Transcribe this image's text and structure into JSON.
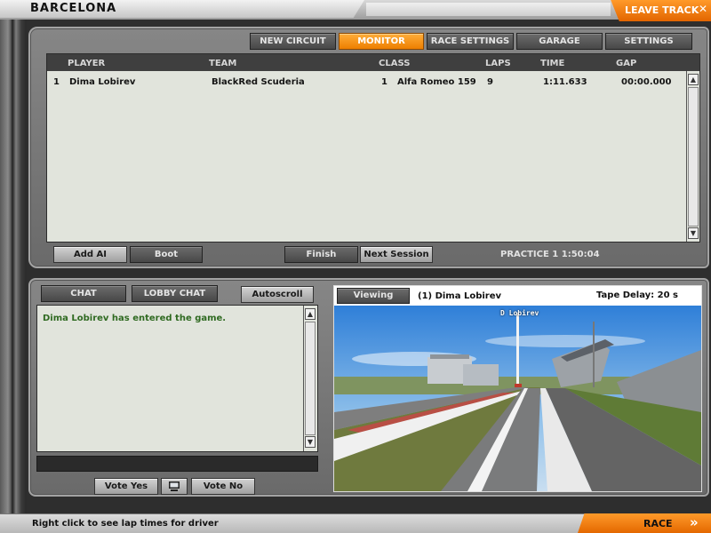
{
  "title_bar": {
    "track_name": "BARCELONA",
    "leave_track_label": "LEAVE TRACK",
    "leave_track_icon": "close-x-icon"
  },
  "tabs": [
    {
      "label": "NEW CIRCUIT",
      "active": false
    },
    {
      "label": "MONITOR",
      "active": true
    },
    {
      "label": "RACE SETTINGS",
      "active": false
    },
    {
      "label": "GARAGE",
      "active": false
    },
    {
      "label": "SETTINGS",
      "active": false
    }
  ],
  "standings": {
    "columns": [
      "PLAYER",
      "TEAM",
      "CLASS",
      "LAPS",
      "TIME",
      "GAP"
    ],
    "rows": [
      {
        "position": "1",
        "player": "Dima Lobirev",
        "team": "BlackRed Scuderia",
        "class_position": "1",
        "class_name": "Alfa Romeo 159",
        "laps": "9",
        "time": "1:11.633",
        "gap": "00:00.000"
      }
    ]
  },
  "session_controls": {
    "add_ai": "Add AI",
    "boot": "Boot",
    "finish": "Finish",
    "next_session": "Next Session",
    "session_info": "PRACTICE 1  1:50:04"
  },
  "chat": {
    "tab_chat": "CHAT",
    "tab_lobby_chat": "LOBBY CHAT",
    "autoscroll": "Autoscroll",
    "messages": [
      "Dima Lobirev has entered the game."
    ],
    "input_value": "",
    "vote_yes": "Vote Yes",
    "vote_no": "Vote No",
    "vote_icon": "computer-monitor-icon"
  },
  "camera": {
    "viewing_button": "Viewing",
    "viewing_driver": "(1) Dima Lobirev",
    "tape_delay": "Tape Delay: 20 s",
    "car_tag": "D Lobirev"
  },
  "status_bar": {
    "hint": "Right click to see lap times for driver",
    "race_label": "RACE",
    "race_icon": "double-chevron-right-icon"
  },
  "colors": {
    "accent_orange": "#f08400",
    "panel_grey": "#787878",
    "list_background": "#e1e4dc",
    "chat_text_green": "#2f6a21"
  }
}
